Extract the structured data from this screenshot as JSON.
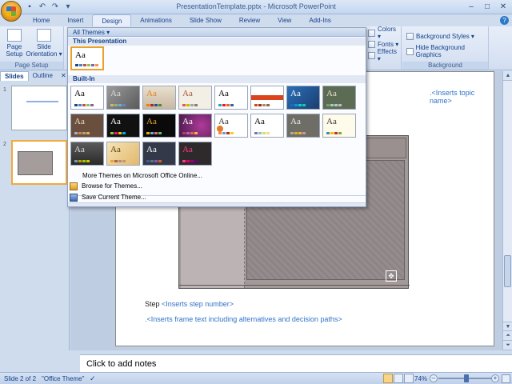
{
  "window": {
    "title": "PresentationTemplate.pptx - Microsoft PowerPoint"
  },
  "tabs": [
    {
      "label": "Home"
    },
    {
      "label": "Insert"
    },
    {
      "label": "Design",
      "active": true
    },
    {
      "label": "Animations"
    },
    {
      "label": "Slide Show"
    },
    {
      "label": "Review"
    },
    {
      "label": "View"
    },
    {
      "label": "Add-Ins"
    }
  ],
  "ribbon": {
    "page_setup_group": "Page Setup",
    "page_setup_btn": "Page Setup",
    "page_setup_l1": "Page",
    "page_setup_l2": "Setup",
    "orient_l1": "Slide",
    "orient_l2": "Orientation ▾",
    "colors": "Colors ▾",
    "fonts": "Fonts ▾",
    "effects": "Effects ▾",
    "bg_styles": "Background Styles ▾",
    "hide_bg": "Hide Background Graphics",
    "bg_group": "Background"
  },
  "themes_dropdown": {
    "header": "All Themes ▾",
    "this_presentation": "This Presentation",
    "built_in": "Built-In",
    "more_online": "More Themes on Microsoft Office Online...",
    "browse": "Browse for Themes...",
    "save_current": "Save Current Theme..."
  },
  "slides_pane": {
    "tab_slides": "Slides",
    "tab_outline": "Outline",
    "thumb1_num": "1",
    "thumb2_num": "2"
  },
  "slide": {
    "topic_name": ".<Inserts topic name>",
    "step_label": "Step ",
    "step_number": "<Inserts step number>",
    "frame_text": ".<Inserts frame text including alternatives and decision paths>"
  },
  "notes": {
    "placeholder": "Click to add notes"
  },
  "status": {
    "slide_of": "Slide 2 of 2",
    "theme": "\"Office Theme\"",
    "zoom": "74%"
  },
  "colors": {
    "accent": "#15428b",
    "placeholder_link": "#3273c6"
  }
}
